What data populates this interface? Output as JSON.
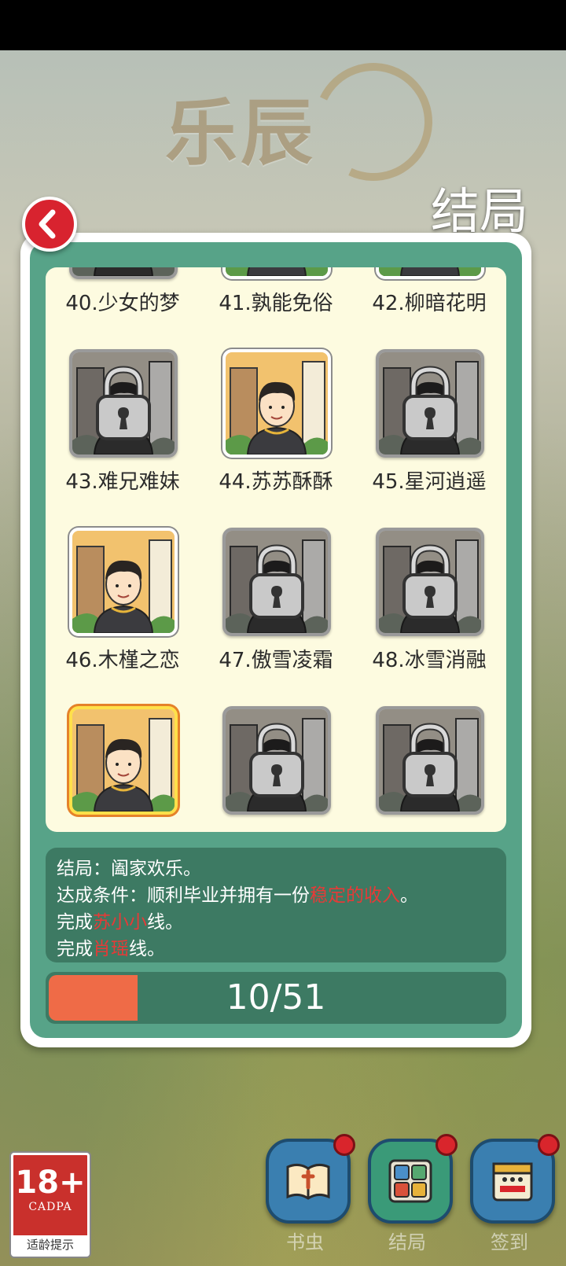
{
  "header": {
    "title": "结局",
    "logo_text": "乐辰"
  },
  "endings": [
    {
      "label": "40.少女的梦",
      "locked": true,
      "selected": false
    },
    {
      "label": "41.孰能免俗",
      "locked": false,
      "selected": false
    },
    {
      "label": "42.柳暗花明",
      "locked": false,
      "selected": false
    },
    {
      "label": "43.难兄难妹",
      "locked": true,
      "selected": false
    },
    {
      "label": "44.苏苏酥酥",
      "locked": false,
      "selected": false
    },
    {
      "label": "45.星河逍遥",
      "locked": true,
      "selected": false
    },
    {
      "label": "46.木槿之恋",
      "locked": false,
      "selected": false
    },
    {
      "label": "47.傲雪凌霜",
      "locked": true,
      "selected": false
    },
    {
      "label": "48.冰雪消融",
      "locked": true,
      "selected": false
    },
    {
      "label": "",
      "locked": false,
      "selected": true
    },
    {
      "label": "",
      "locked": true,
      "selected": false
    },
    {
      "label": "",
      "locked": true,
      "selected": false
    }
  ],
  "info": {
    "ending_line": "结局：阖家欢乐。",
    "condition_prefix": "达成条件：顺利毕业并拥有一份",
    "condition_highlight": "稳定的收入",
    "condition_suffix": "。",
    "line3_prefix": "完成",
    "line3_highlight": "苏小小",
    "line3_suffix": "线。",
    "line4_prefix": "完成",
    "line4_highlight": "肖瑶",
    "line4_suffix": "线。"
  },
  "progress": {
    "text": "10/51",
    "unlocked": 10,
    "total": 51
  },
  "age_rating": {
    "number": "18+",
    "org": "CADPA",
    "tip": "适龄提示"
  },
  "nav": [
    {
      "label": "书虫",
      "icon": "book-icon",
      "color": "#3a7fb0"
    },
    {
      "label": "结局",
      "icon": "grid-icon",
      "color": "#3a9a78"
    },
    {
      "label": "签到",
      "icon": "calendar-icon",
      "color": "#3a7fb0"
    }
  ],
  "colors": {
    "panel": "#57a388",
    "info_bg": "#3d7a63",
    "highlight": "#e63a37",
    "progress_fill": "#ef6b47"
  }
}
